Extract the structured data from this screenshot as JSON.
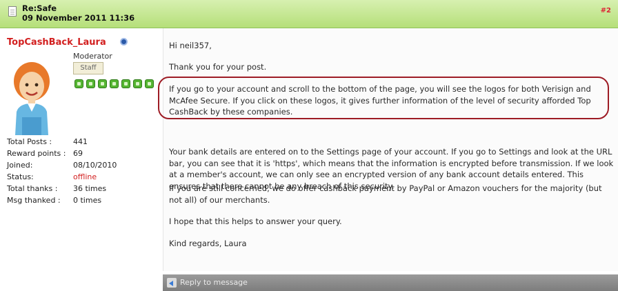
{
  "post": {
    "title": "Re:Safe",
    "date": "09 November 2011 11:36",
    "number": "#2"
  },
  "author": {
    "username": "TopCashBack_Laura",
    "role": "Moderator",
    "badge": "Staff",
    "stats": [
      {
        "label": "Total Posts :",
        "value": "441"
      },
      {
        "label": "Reward points :",
        "value": "69"
      },
      {
        "label": "Joined:",
        "value": "08/10/2010"
      },
      {
        "label": "Status:",
        "value": "offline"
      },
      {
        "label": "Total thanks :",
        "value": "36 times"
      },
      {
        "label": "Msg thanked :",
        "value": "0 times"
      }
    ]
  },
  "message": {
    "greeting": "Hi neil357,",
    "thanks": "Thank you for your post.",
    "highlighted": "If you go to your account and scroll to the bottom of the page, you will see the logos for both Verisign and McAfee Secure. If you click on these logos, it gives further information of the level of security afforded Top CashBack by these companies.",
    "bank_details": "Your bank details are entered on to the Settings page of your account. If you go to Settings and look at the URL bar, you can see that it is 'https', which means that the information is encrypted before transmission. If we look at a member's account, we can only see an encrypted version of any bank account details entered. This ensures that there cannot be any breach of this security.",
    "concerned": "If you are still concerned, we do offer cashback payment by PayPal or Amazon vouchers for the majority (but not all) of our merchants.",
    "hope": "I hope that this helps to answer your query.",
    "signoff": "Kind regards, Laura"
  },
  "reply": {
    "label": "Reply to message"
  },
  "colors": {
    "header_green": "#b5df79",
    "username_red": "#d21f1f",
    "highlight_border": "#9d1b24",
    "reply_bar_gray": "#7d7d7d"
  }
}
